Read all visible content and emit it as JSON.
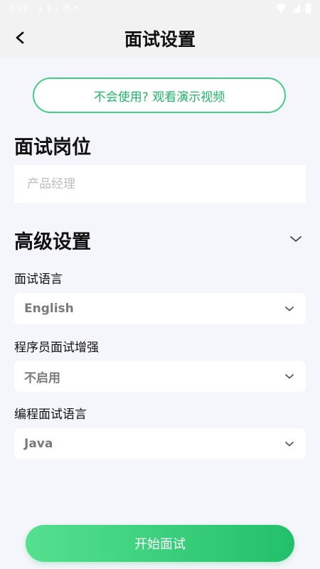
{
  "status_bar": {
    "time": "5:42",
    "notification_icons": [
      "download-icon",
      "download-icon",
      "download-icon",
      "photo-icon",
      "dot-icon"
    ],
    "system_icons": [
      "wifi-icon",
      "signal-icon",
      "battery-icon"
    ]
  },
  "header": {
    "title": "面试设置",
    "back_icon": "chevron-left-icon"
  },
  "demo_button": {
    "label": "不会使用? 观看演示视频"
  },
  "position_section": {
    "title": "面试岗位",
    "input_value": "",
    "input_placeholder": "产品经理"
  },
  "advanced_section": {
    "title": "高级设置",
    "toggle_icon": "chevron-down-icon",
    "fields": [
      {
        "label": "面试语言",
        "value": "English"
      },
      {
        "label": "程序员面试增强",
        "value": "不启用"
      },
      {
        "label": "编程面试语言",
        "value": "Java"
      }
    ]
  },
  "start_button": {
    "label": "开始面试"
  },
  "colors": {
    "accent": "#3fcf84",
    "accent_text": "#1fb866",
    "gradient_start": "#55e08f",
    "gradient_end": "#22c06b",
    "page_bg": "#f5f6fb",
    "header_bg": "#f2f2f2"
  }
}
